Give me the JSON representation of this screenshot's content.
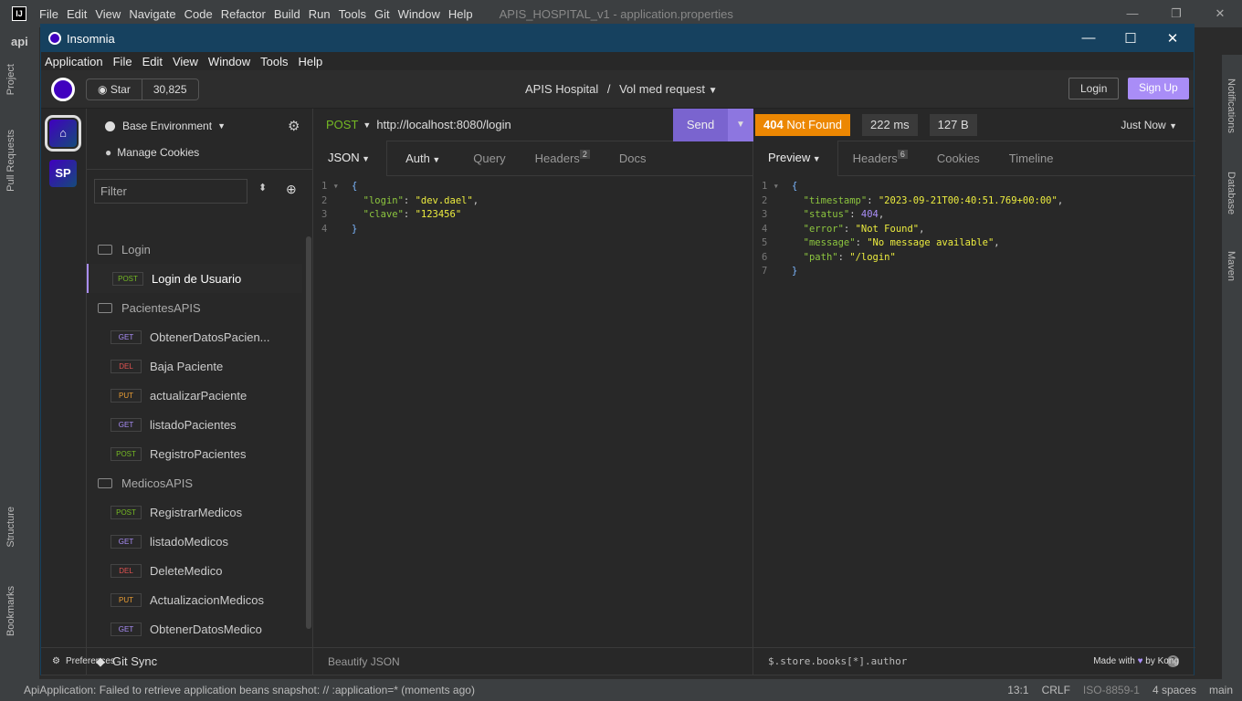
{
  "ide": {
    "menu": [
      "File",
      "Edit",
      "View",
      "Navigate",
      "Code",
      "Refactor",
      "Build",
      "Run",
      "Tools",
      "Git",
      "Window",
      "Help"
    ],
    "project_title": "APIS_HOSPITAL_v1 - application.properties",
    "breadcrumb": "api",
    "left_tools": [
      "Project",
      "Pull Requests",
      "Structure",
      "Bookmarks"
    ],
    "right_tools": [
      "Notifications",
      "Database",
      "Maven"
    ],
    "status": {
      "message": "ApiApplication: Failed to retrieve application beans snapshot: // :application=* (moments ago)",
      "position": "13:1",
      "line_sep": "CRLF",
      "encoding": "ISO-8859-1",
      "indent": "4 spaces",
      "branch": "main"
    }
  },
  "insomnia": {
    "window_title": "Insomnia",
    "menu": [
      "Application",
      "File",
      "Edit",
      "View",
      "Window",
      "Tools",
      "Help"
    ],
    "star_label": "Star",
    "star_count": "30,825",
    "collection": "APIS Hospital",
    "separator": "/",
    "request_title": "Vol med request",
    "login": "Login",
    "signup": "Sign Up",
    "workspaces": [
      "SP"
    ],
    "sidebar": {
      "environment": "Base Environment",
      "cookies": "Manage Cookies",
      "filter_placeholder": "Filter",
      "tree": [
        {
          "type": "folder",
          "label": "Login"
        },
        {
          "type": "request",
          "method": "POST",
          "label": "Login de Usuario",
          "active": true
        },
        {
          "type": "folder",
          "label": "PacientesAPIS"
        },
        {
          "type": "request",
          "method": "GET",
          "label": "ObtenerDatosPacien..."
        },
        {
          "type": "request",
          "method": "DEL",
          "label": "Baja Paciente"
        },
        {
          "type": "request",
          "method": "PUT",
          "label": "actualizarPaciente"
        },
        {
          "type": "request",
          "method": "GET",
          "label": "listadoPacientes"
        },
        {
          "type": "request",
          "method": "POST",
          "label": "RegistroPacientes"
        },
        {
          "type": "folder",
          "label": "MedicosAPIS"
        },
        {
          "type": "request",
          "method": "POST",
          "label": "RegistrarMedicos"
        },
        {
          "type": "request",
          "method": "GET",
          "label": "listadoMedicos"
        },
        {
          "type": "request",
          "method": "DEL",
          "label": "DeleteMedico"
        },
        {
          "type": "request",
          "method": "PUT",
          "label": "ActualizacionMedicos"
        },
        {
          "type": "request",
          "method": "GET",
          "label": "ObtenerDatosMedico"
        }
      ],
      "git_sync": "Git Sync"
    },
    "request": {
      "method": "POST",
      "url": "http://localhost:8080/login",
      "send": "Send",
      "tabs": [
        {
          "label": "JSON"
        },
        {
          "label": "Auth"
        },
        {
          "label": "Query"
        },
        {
          "label": "Headers",
          "badge": "2"
        },
        {
          "label": "Docs"
        }
      ],
      "body_lines": [
        [
          "{"
        ],
        [
          "  ",
          "\"login\"",
          ": ",
          "\"dev.dael\"",
          ","
        ],
        [
          "  ",
          "\"clave\"",
          ": ",
          "\"123456\""
        ],
        [
          "}"
        ]
      ],
      "beautify": "Beautify JSON"
    },
    "response": {
      "status_code": "404",
      "status_text": "Not Found",
      "status_color": "#ec8702",
      "time": "222 ms",
      "size": "127 B",
      "when": "Just Now",
      "tabs": [
        {
          "label": "Preview"
        },
        {
          "label": "Headers",
          "badge": "6"
        },
        {
          "label": "Cookies"
        },
        {
          "label": "Timeline"
        }
      ],
      "body_lines": [
        [
          "{"
        ],
        [
          "  ",
          "\"timestamp\"",
          ": ",
          "\"2023-09-21T00:40:51.769+00:00\"",
          ","
        ],
        [
          "  ",
          "\"status\"",
          ": ",
          "404",
          ","
        ],
        [
          "  ",
          "\"error\"",
          ": ",
          "\"Not Found\"",
          ","
        ],
        [
          "  ",
          "\"message\"",
          ": ",
          "\"No message available\"",
          ","
        ],
        [
          "  ",
          "\"path\"",
          ": ",
          "\"/login\""
        ],
        [
          "}"
        ]
      ],
      "filter_placeholder": "$.store.books[*].author"
    },
    "footer": {
      "preferences": "Preferences",
      "made_with": "Made with",
      "by": "by Kong"
    }
  }
}
